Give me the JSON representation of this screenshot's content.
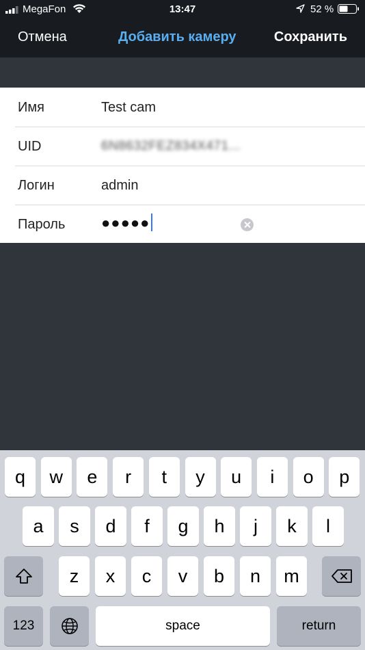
{
  "status_bar": {
    "carrier": "MegaFon",
    "time": "13:47",
    "battery_percent": "52 %",
    "battery_level": 0.52
  },
  "nav": {
    "cancel_label": "Отмена",
    "title": "Добавить камеру",
    "save_label": "Сохранить"
  },
  "form": {
    "rows": [
      {
        "label": "Имя",
        "value": "Test cam"
      },
      {
        "label": "UID",
        "value": "6N8632FEZ834X471..."
      },
      {
        "label": "Логин",
        "value": "admin"
      },
      {
        "label": "Пароль",
        "value": "●●●●●"
      }
    ]
  },
  "keyboard": {
    "row1": [
      "q",
      "w",
      "e",
      "r",
      "t",
      "y",
      "u",
      "i",
      "o",
      "p"
    ],
    "row2": [
      "a",
      "s",
      "d",
      "f",
      "g",
      "h",
      "j",
      "k",
      "l"
    ],
    "row3": [
      "z",
      "x",
      "c",
      "v",
      "b",
      "n",
      "m"
    ],
    "numbers_label": "123",
    "space_label": "space",
    "return_label": "return"
  },
  "colors": {
    "nav_bg": "#181b20",
    "page_bg": "#30343b",
    "title_accent": "#5aaef0",
    "caret": "#3478f6",
    "keyboard_bg": "#d0d3d9",
    "key_fn_bg": "#aeb3be"
  },
  "icons": {
    "signal": "signal-strength-icon",
    "wifi": "wifi-icon",
    "location": "location-arrow-icon",
    "battery": "battery-icon",
    "clear": "clear-text-icon",
    "shift": "shift-icon",
    "globe": "globe-icon",
    "delete": "backspace-icon"
  }
}
